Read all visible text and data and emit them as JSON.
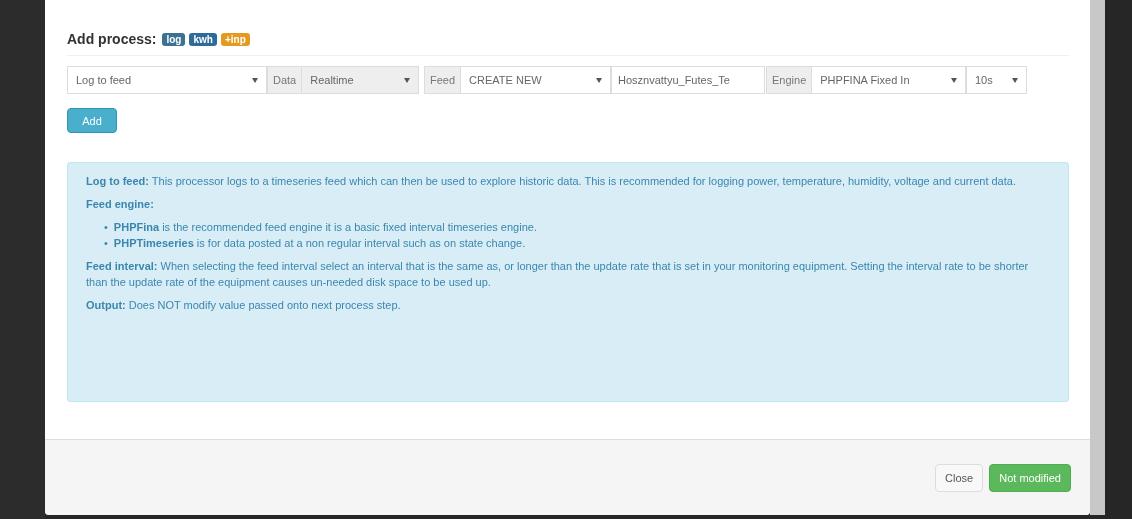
{
  "header": {
    "title": "Add process:",
    "tags": [
      {
        "label": "log",
        "color": "#3b7191"
      },
      {
        "label": "kwh",
        "color": "#2f6b98"
      },
      {
        "label": "+inp",
        "color": "#e39a1f"
      }
    ]
  },
  "controls": [
    {
      "kind": "select",
      "value": "Log to feed"
    },
    {
      "kind": "labeled-select",
      "label": "Data",
      "value": "Realtime",
      "disabled": true
    },
    {
      "kind": "labeled-select",
      "label": "Feed",
      "value": "CREATE NEW",
      "disabled": false
    },
    {
      "kind": "input",
      "value": "Hosznvattyu_Futes_Te"
    },
    {
      "kind": "labeled-select",
      "label": "Engine",
      "value": "PHPFINA Fixed In",
      "disabled": false
    },
    {
      "kind": "select",
      "value": "10s"
    }
  ],
  "add_button": "Add",
  "info": {
    "paragraphs": [
      {
        "kind": "text",
        "text": "**Log to feed:** This processor logs to a timeseries feed which can then be used to explore historic data. This is recommended for logging power, temperature, humidity, voltage and current data."
      },
      {
        "kind": "text",
        "text": "**Feed engine:**"
      },
      {
        "kind": "list",
        "marker": "•",
        "items": [
          "**PHPFina** is the recommended feed engine it is a basic fixed interval timeseries engine.",
          "**PHPTimeseries** is for data posted at a non regular interval such as on state change."
        ]
      },
      {
        "kind": "text",
        "text": "**Feed interval:** When selecting the feed interval select an interval that is the same as, or longer than the update rate that is set in your monitoring equipment. Setting the interval rate to be shorter than the update rate of the equipment causes un-needed disk space to be used up."
      },
      {
        "kind": "text",
        "text": "**Output:** Does NOT modify value passed onto next process step."
      }
    ]
  },
  "footer": {
    "buttons": [
      {
        "label": "Close",
        "kind": "default"
      },
      {
        "label": "Not modified",
        "kind": "success"
      }
    ]
  }
}
